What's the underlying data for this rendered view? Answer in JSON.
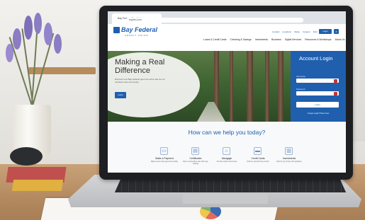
{
  "scene": {
    "description_free": true
  },
  "browser": {
    "tab_title": "Bay Federal Credit Union",
    "address": "bayfed.com"
  },
  "site": {
    "logo": {
      "name": "Bay Federal",
      "subtitle": "CREDIT UNION"
    },
    "utility_links": [
      "Contact",
      "Locations",
      "Rates",
      "Careers",
      "FAQ"
    ],
    "login_button": "Login",
    "nav": [
      "Loans & Credit Cards",
      "Checking & Savings",
      "Investments",
      "Business",
      "Digital Services",
      "Resources & Workshops",
      "About Us"
    ],
    "hero": {
      "title": "Making a Real Difference",
      "subtitle": "Discover how Bay Federal goes the extra mile for our members and community.",
      "button": "Learn"
    },
    "login_panel": {
      "title": "Account Login",
      "username_label": "Username",
      "password_label": "Password",
      "submit": "Login",
      "help": "Forgot Login? New User"
    },
    "help_section": {
      "title": "How can we help you today?",
      "services": [
        {
          "icon": "payment-icon",
          "name": "Make a Payment",
          "desc": "Make secure loan payments quickly"
        },
        {
          "icon": "certificate-icon",
          "name": "Certificates",
          "desc": "Earn a competitive rate with easy savings"
        },
        {
          "icon": "home-icon",
          "name": "Mortgage",
          "desc": "Find the perfect home loan"
        },
        {
          "icon": "card-icon",
          "name": "Credit Cards",
          "desc": "Find the card that fits your life"
        },
        {
          "icon": "invest-icon",
          "name": "Investments",
          "desc": "Plan for your future with guidance"
        }
      ]
    }
  },
  "colors": {
    "brand_blue": "#1f5fae",
    "alert_red": "#c7332c"
  }
}
